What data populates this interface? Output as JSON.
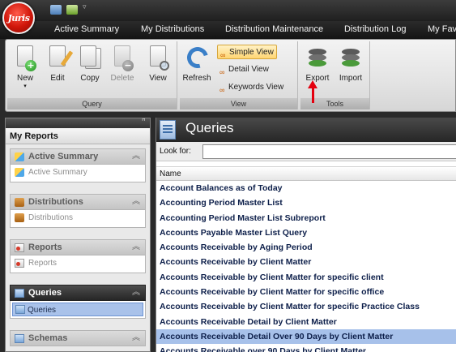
{
  "app": {
    "orb_label": "Juris"
  },
  "tabs": [
    "Active Summary",
    "My Distributions",
    "Distribution Maintenance",
    "Distribution Log",
    "My Fav"
  ],
  "ribbon": {
    "query_group": {
      "label": "Query",
      "buttons": [
        "New",
        "Edit",
        "Copy",
        "Delete",
        "View"
      ]
    },
    "view_group": {
      "label": "View",
      "refresh": "Refresh",
      "options": [
        "Simple View",
        "Detail View",
        "Keywords View"
      ],
      "selected": "Simple View"
    },
    "tools_group": {
      "label": "Tools",
      "buttons": [
        "Export",
        "Import"
      ]
    }
  },
  "nav": {
    "title": "My Reports",
    "groups": [
      {
        "head": "Active Summary",
        "item": "Active Summary",
        "icon": "star-icon"
      },
      {
        "head": "Distributions",
        "item": "Distributions",
        "icon": "distribution-icon"
      },
      {
        "head": "Reports",
        "item": "Reports",
        "icon": "report-icon"
      },
      {
        "head": "Queries",
        "item": "Queries",
        "icon": "query-icon",
        "active": true
      },
      {
        "head": "Schemas"
      }
    ]
  },
  "main": {
    "title": "Queries",
    "look_for_label": "Look for:",
    "look_for_value": "",
    "column_header": "Name",
    "rows": [
      "Account Balances as of Today",
      "Accounting Period Master List",
      "Accounting Period Master List Subreport",
      "Accounts Payable Master List Query",
      "Accounts Receivable by Aging Period",
      "Accounts Receivable by Client Matter",
      "Accounts Receivable by Client Matter for specific client",
      "Accounts Receivable by Client Matter for specific office",
      "Accounts Receivable by Client Matter for specific Practice Class",
      "Accounts Receivable Detail by Client Matter",
      "Accounts Receivable Detail Over 90 Days by Client Matter",
      "Accounts Receivable over 90 Days by Client Matter"
    ],
    "selected_row": 10
  }
}
